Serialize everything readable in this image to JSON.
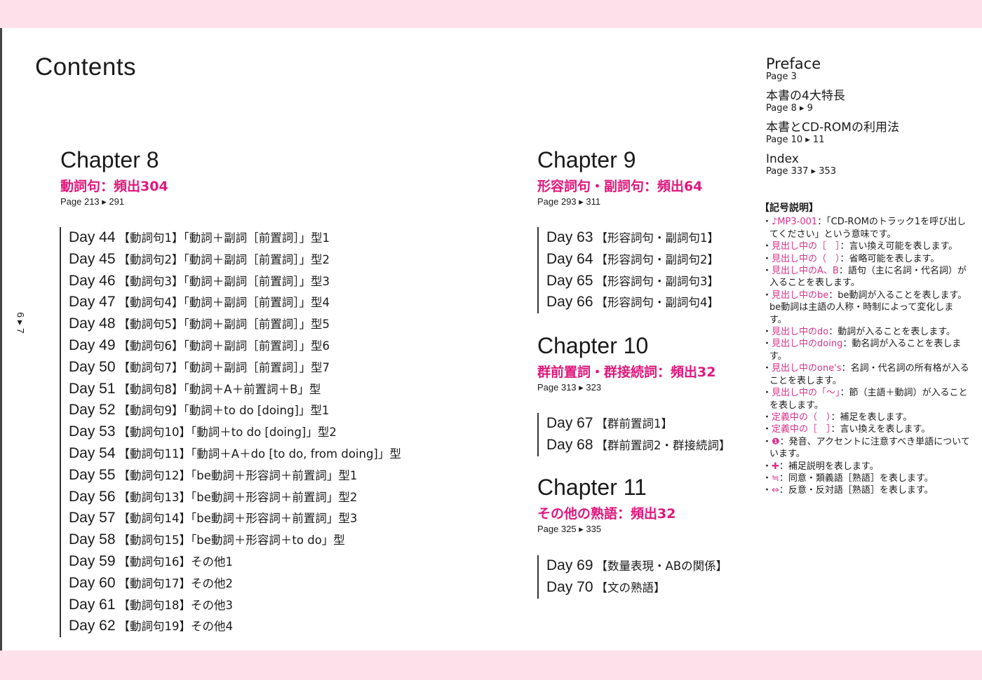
{
  "title": "Contents",
  "folio": "6 ▸ 7",
  "chapters": [
    {
      "heading": "Chapter 8",
      "subtitle": "動詞句：頻出304",
      "pages": "Page 213 ▸ 291",
      "days": [
        [
          "Day 44",
          "【動詞句1】「動詞＋副詞［前置詞］」型1"
        ],
        [
          "Day 45",
          "【動詞句2】「動詞＋副詞［前置詞］」型2"
        ],
        [
          "Day 46",
          "【動詞句3】「動詞＋副詞［前置詞］」型3"
        ],
        [
          "Day 47",
          "【動詞句4】「動詞＋副詞［前置詞］」型4"
        ],
        [
          "Day 48",
          "【動詞句5】「動詞＋副詞［前置詞］」型5"
        ],
        [
          "Day 49",
          "【動詞句6】「動詞＋副詞［前置詞］」型6"
        ],
        [
          "Day 50",
          "【動詞句7】「動詞＋副詞［前置詞］」型7"
        ],
        [
          "Day 51",
          "【動詞句8】「動詞＋A＋前置詞＋B」型"
        ],
        [
          "Day 52",
          "【動詞句9】「動詞＋to do [doing]」型1"
        ],
        [
          "Day 53",
          "【動詞句10】「動詞＋to do [doing]」型2"
        ],
        [
          "Day 54",
          "【動詞句11】「動詞＋A＋do [to do, from doing]」型"
        ],
        [
          "Day 55",
          "【動詞句12】「be動詞＋形容詞＋前置詞」型1"
        ],
        [
          "Day 56",
          "【動詞句13】「be動詞＋形容詞＋前置詞」型2"
        ],
        [
          "Day 57",
          "【動詞句14】「be動詞＋形容詞＋前置詞」型3"
        ],
        [
          "Day 58",
          "【動詞句15】「be動詞＋形容詞＋to do」型"
        ],
        [
          "Day 59",
          "【動詞句16】その他1"
        ],
        [
          "Day 60",
          "【動詞句17】その他2"
        ],
        [
          "Day 61",
          "【動詞句18】その他3"
        ],
        [
          "Day 62",
          "【動詞句19】その他4"
        ]
      ]
    },
    {
      "heading": "Chapter 9",
      "subtitle": "形容詞句・副詞句：頻出64",
      "pages": "Page 293 ▸ 311",
      "days": [
        [
          "Day 63",
          "【形容詞句・副詞句1】"
        ],
        [
          "Day 64",
          "【形容詞句・副詞句2】"
        ],
        [
          "Day 65",
          "【形容詞句・副詞句3】"
        ],
        [
          "Day 66",
          "【形容詞句・副詞句4】"
        ]
      ]
    },
    {
      "heading": "Chapter 10",
      "subtitle": "群前置詞・群接続詞：頻出32",
      "pages": "Page 313 ▸ 323",
      "days": [
        [
          "Day 67",
          "【群前置詞1】"
        ],
        [
          "Day 68",
          "【群前置詞2・群接続詞】"
        ]
      ]
    },
    {
      "heading": "Chapter 11",
      "subtitle": "その他の熟語：頻出32",
      "pages": "Page 325 ▸ 335",
      "days": [
        [
          "Day 69",
          "【数量表現・ABの関係】"
        ],
        [
          "Day 70",
          "【文の熟語】"
        ]
      ]
    }
  ],
  "side": [
    {
      "heading": "Preface",
      "pages": "Page 3"
    },
    {
      "heading": "本書の4大特長",
      "pages": "Page 8 ▸ 9"
    },
    {
      "heading": "本書とCD-ROMの利用法",
      "pages": "Page 10 ▸ 11"
    },
    {
      "heading": "Index",
      "pages": "Page 337 ▸ 353"
    }
  ],
  "legend": {
    "heading": "【記号説明】",
    "items": [
      [
        "♪MP3-001",
        "：「CD-ROMのトラック1を呼び出してください」という意味です。"
      ],
      [
        "見出し中の［　］",
        "：言い換え可能を表します。"
      ],
      [
        "見出し中の（　）",
        "：省略可能を表します。"
      ],
      [
        "見出し中のA、B",
        "：語句（主に名詞・代名詞）が入ることを表します。"
      ],
      [
        "見出し中のbe",
        "：be動詞が入ることを表します。be動詞は主語の人称・時制によって変化します。"
      ],
      [
        "見出し中のdo",
        "：動詞が入ることを表します。"
      ],
      [
        "見出し中のdoing",
        "：動名詞が入ることを表します。"
      ],
      [
        "見出し中のone's",
        "：名詞・代名詞の所有格が入ることを表します。"
      ],
      [
        "見出し中の「～」",
        "：節（主語＋動詞）が入ることを表します。"
      ],
      [
        "定義中の（　）",
        "：補足を表します。"
      ],
      [
        "定義中の［　］",
        "：言い換えを表します。"
      ],
      [
        "❶",
        "：発音、アクセントに注意すべき単語についています。"
      ],
      [
        "✚",
        "：補足説明を表します。"
      ],
      [
        "≒",
        "：同意・類義語［熟語］を表します。"
      ],
      [
        "⇔",
        "：反意・反対語［熟語］を表します。"
      ]
    ]
  },
  "colors": {
    "accent": "#e0187c",
    "band": "#fde1ea"
  }
}
